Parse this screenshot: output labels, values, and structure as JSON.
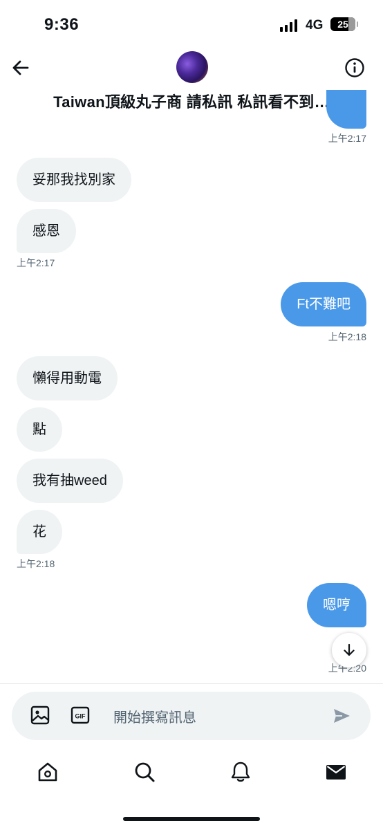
{
  "status_bar": {
    "time": "9:36",
    "network": "4G",
    "battery": "25"
  },
  "header": {
    "title": "Taiwan頂級丸子商 請私訊 私訊看不到…",
    "back_icon": "arrow-left-icon",
    "info_icon": "info-icon"
  },
  "conversation": {
    "messages": [
      {
        "side": "out",
        "text": "",
        "time": "上午2:17"
      },
      {
        "side": "in",
        "text": "妥那我找別家"
      },
      {
        "side": "in",
        "text": "感恩",
        "time": "上午2:17"
      },
      {
        "side": "out",
        "text": "Ft不難吧",
        "time": "上午2:18"
      },
      {
        "side": "in",
        "text": "懶得用動電"
      },
      {
        "side": "in",
        "text": "點"
      },
      {
        "side": "in",
        "text": "我有抽weed"
      },
      {
        "side": "in",
        "text": "花",
        "time": "上午2:18"
      },
      {
        "side": "out",
        "text": "嗯哼",
        "time": "上午2:20"
      }
    ]
  },
  "composer": {
    "placeholder": "開始撰寫訊息",
    "icons": [
      "image-icon",
      "gif-icon",
      "send-icon"
    ]
  },
  "bottom_nav": {
    "items": [
      "home-icon",
      "search-icon",
      "notifications-icon",
      "messages-icon"
    ]
  },
  "colors": {
    "outgoing_bubble": "#4a99e9",
    "incoming_bubble": "#eff3f4",
    "timestamp": "#536471"
  }
}
